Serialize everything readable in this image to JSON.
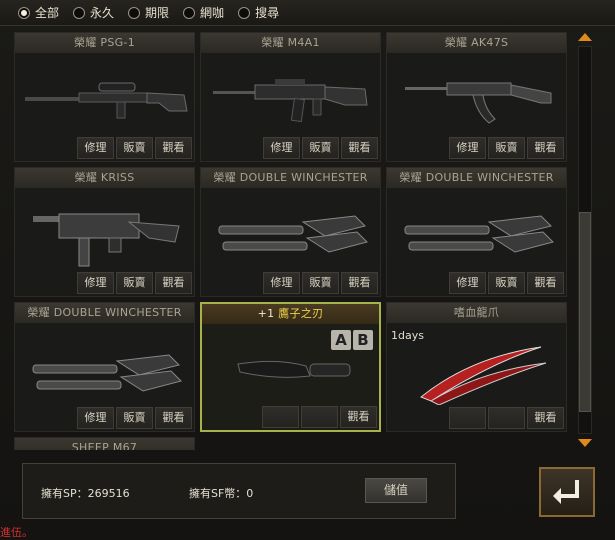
{
  "filters": [
    {
      "label": "全部",
      "selected": true
    },
    {
      "label": "永久",
      "selected": false
    },
    {
      "label": "期限",
      "selected": false
    },
    {
      "label": "網咖",
      "selected": false
    },
    {
      "label": "搜尋",
      "selected": false
    }
  ],
  "slots": [
    {
      "title": "榮耀 PSG-1",
      "buttons": [
        "修理",
        "販賣",
        "觀看"
      ],
      "icon": "sniper-rifle-icon"
    },
    {
      "title": "榮耀 M4A1",
      "buttons": [
        "修理",
        "販賣",
        "觀看"
      ],
      "icon": "assault-rifle-icon"
    },
    {
      "title": "榮耀 AK47S",
      "buttons": [
        "修理",
        "販賣",
        "觀看"
      ],
      "icon": "ak-rifle-icon"
    },
    {
      "title": "榮耀 KRISS",
      "buttons": [
        "修理",
        "販賣",
        "觀看"
      ],
      "icon": "smg-icon"
    },
    {
      "title": "榮耀 DOUBLE WINCHESTER",
      "buttons": [
        "修理",
        "販賣",
        "觀看"
      ],
      "icon": "double-shotgun-icon"
    },
    {
      "title": "榮耀 DOUBLE WINCHESTER",
      "buttons": [
        "修理",
        "販賣",
        "觀看"
      ],
      "icon": "double-shotgun-icon"
    },
    {
      "title": "榮耀 DOUBLE WINCHESTER",
      "buttons": [
        "修理",
        "販賣",
        "觀看"
      ],
      "icon": "double-shotgun-icon"
    },
    {
      "title_prefix": "+1 ",
      "title": "鷹子之刃",
      "badges": [
        "A",
        "B"
      ],
      "buttons": [
        "觀看"
      ],
      "icon": "knife-icon",
      "selected": true
    },
    {
      "title": "嗜血龍爪",
      "days": "1days",
      "buttons": [
        "觀看"
      ],
      "icon": "claw-icon"
    },
    {
      "title": "SHEEP M67"
    }
  ],
  "footer": {
    "sp_label": "擁有SP：269516",
    "sf_label": "擁有SF幣：0",
    "deposit_label": "儲值"
  },
  "corner_text": "進伍。",
  "colors": {
    "accent": "#e08a1a",
    "selected_border": "#a8b24a"
  }
}
